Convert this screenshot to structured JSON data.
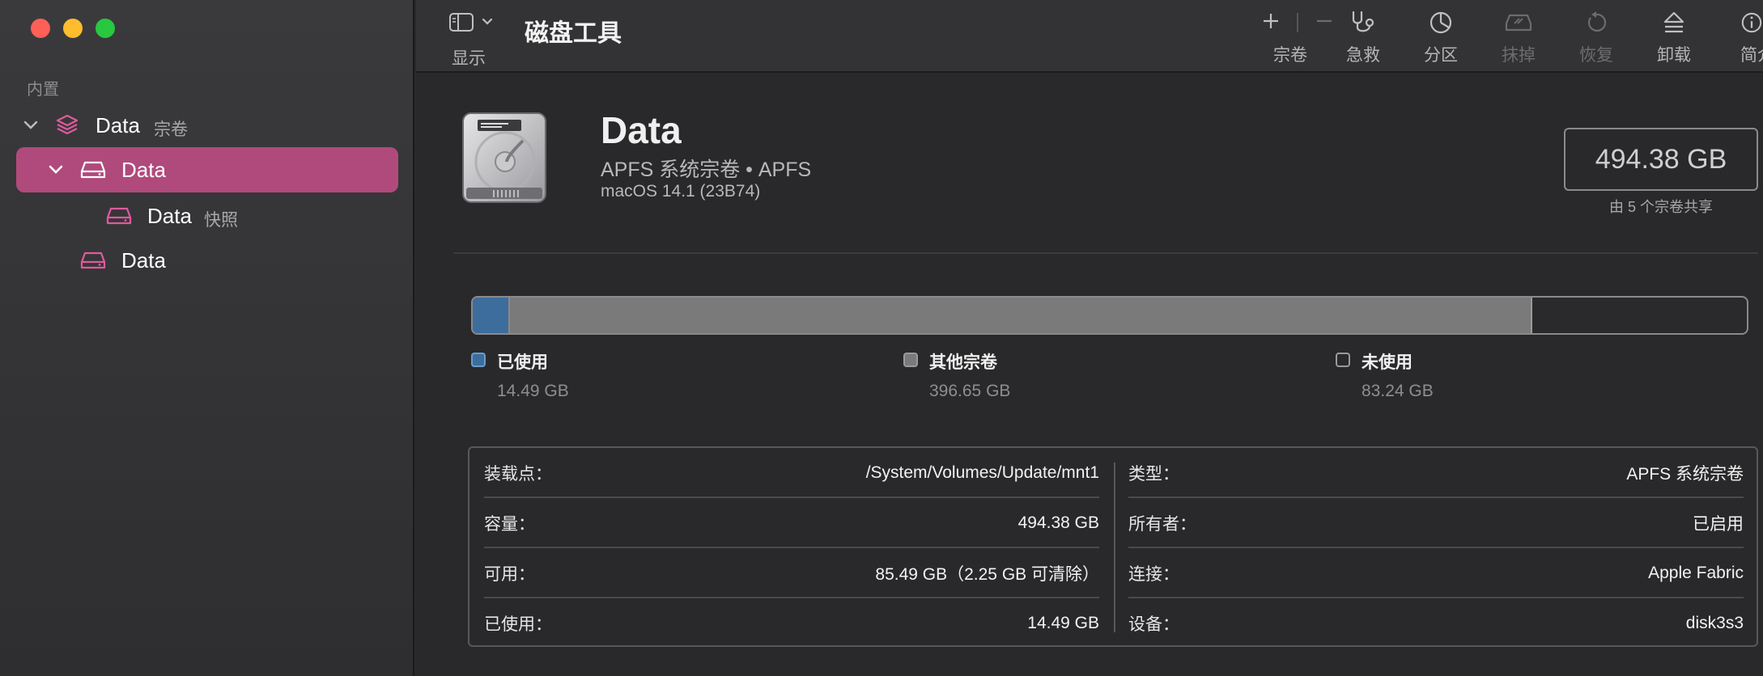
{
  "sidebar": {
    "section_label": "内置",
    "items": [
      {
        "name": "Data",
        "sub": "宗卷"
      },
      {
        "name": "Data",
        "sub": ""
      },
      {
        "name": "Data",
        "sub": "快照"
      },
      {
        "name": "Data",
        "sub": ""
      }
    ]
  },
  "toolbar": {
    "view_label": "显示",
    "app_title": "磁盘工具",
    "buttons": {
      "volume": "宗卷",
      "first_aid": "急救",
      "partition": "分区",
      "erase": "抹掉",
      "restore": "恢复",
      "unmount": "卸载",
      "info": "简介"
    },
    "add_symbol": "+",
    "remove_symbol": "−"
  },
  "volume": {
    "name": "Data",
    "type_line": "APFS 系统宗卷 • APFS",
    "os_line": "macOS 14.1 (23B74)",
    "capacity": "494.38 GB",
    "capacity_note": "由 5 个宗卷共享"
  },
  "usage": {
    "total_gb": 494.38,
    "used_gb": 14.49,
    "other_gb": 396.65,
    "free_gb": 83.24,
    "colors": {
      "used": "#3d6d9c",
      "other": "#7a7a7a",
      "free": "#2a2a2c"
    },
    "legend": [
      {
        "name": "已使用",
        "value": "14.49 GB"
      },
      {
        "name": "其他宗卷",
        "value": "396.65 GB"
      },
      {
        "name": "未使用",
        "value": "83.24 GB"
      }
    ]
  },
  "info": {
    "left": [
      {
        "k": "装载点：",
        "v": "/System/Volumes/Update/mnt1"
      },
      {
        "k": "容量：",
        "v": "494.38 GB"
      },
      {
        "k": "可用：",
        "v": "85.49 GB（2.25 GB 可清除）"
      },
      {
        "k": "已使用：",
        "v": "14.49 GB"
      }
    ],
    "right": [
      {
        "k": "类型：",
        "v": "APFS 系统宗卷"
      },
      {
        "k": "所有者：",
        "v": "已启用"
      },
      {
        "k": "连接：",
        "v": "Apple Fabric"
      },
      {
        "k": "设备：",
        "v": "disk3s3"
      }
    ]
  },
  "colors": {
    "accent": "#b04a7c",
    "icon_pink": "#e05a9c"
  }
}
